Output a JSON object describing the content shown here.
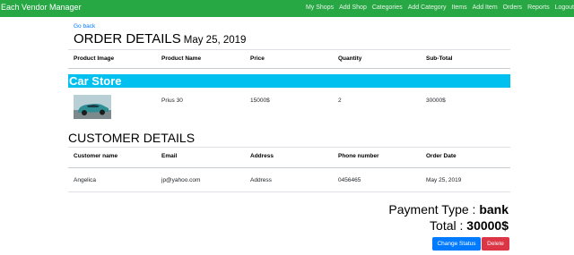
{
  "navbar": {
    "brand": "Each Vendor Manager",
    "links": [
      "My Shops",
      "Add Shop",
      "Categories",
      "Add Category",
      "Items",
      "Add Item",
      "Orders",
      "Reports",
      "Logout"
    ]
  },
  "page": {
    "back_link": "Go back",
    "title": "ORDER DETAILS",
    "date": "May 25, 2019"
  },
  "order_table": {
    "headers": [
      "Product Image",
      "Product Name",
      "Price",
      "Quantity",
      "Sub-Total"
    ],
    "store_name": "Car Store",
    "rows": [
      {
        "product_name": "Prius 30",
        "price": "15000$",
        "quantity": "2",
        "subtotal": "30000$"
      }
    ]
  },
  "customer": {
    "section_title": "CUSTOMER DETAILS",
    "headers": [
      "Customer name",
      "Email",
      "Address",
      "Phone number",
      "Order Date"
    ],
    "row": {
      "name": "Angelica",
      "email": "jp@yahoo.com",
      "address": "Address",
      "phone": "0456465",
      "order_date": "May 25, 2019"
    }
  },
  "summary": {
    "payment_label": "Payment Type :",
    "payment_value": "bank",
    "total_label": "Total :",
    "total_value": "30000$"
  },
  "actions": {
    "change_status": "Change Status",
    "delete": "Delete"
  },
  "colors": {
    "navbar": "#28a745",
    "store_bar": "#00c0ef",
    "primary": "#007bff",
    "danger": "#dc3545"
  }
}
